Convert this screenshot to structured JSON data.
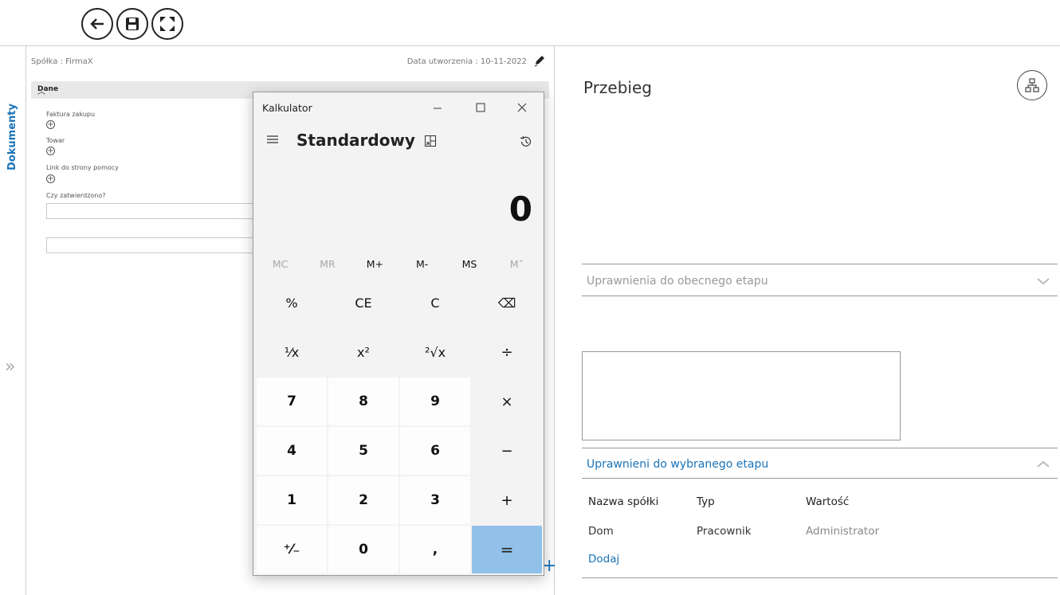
{
  "toolbar": {
    "buttons": [
      {
        "icon": "back-arrow-icon"
      },
      {
        "icon": "save-icon"
      },
      {
        "icon": "fullscreen-icon"
      }
    ]
  },
  "side_tab": {
    "label": "Dokumenty"
  },
  "document": {
    "company": "Spółka : FirmaX",
    "created": "Data utworzenia : 10-11-2022",
    "section_title": "Dane",
    "fields": {
      "invoice": "Faktura zakupu",
      "goods": "Towar",
      "help_link": "Link do strony pomocy",
      "approved": "Czy zatwierdzono?"
    }
  },
  "right_panel": {
    "title": "Przebieg",
    "current_permissions": "Uprawnienia do obecnego etapu",
    "selected_permissions": "Uprawnieni do wybranego etapu",
    "table": {
      "headers": [
        "Nazwa spółki",
        "Typ",
        "Wartość"
      ],
      "row": [
        "Dom",
        "Pracownik",
        "Administrator"
      ]
    },
    "add_label": "Dodaj"
  },
  "calculator": {
    "window_title": "Kalkulator",
    "mode": "Standardowy",
    "display": "0",
    "memory": [
      "MC",
      "MR",
      "M+",
      "M-",
      "MS",
      "M˅"
    ],
    "keys": {
      "percent": "%",
      "ce": "CE",
      "c": "C",
      "backspace": "⌫",
      "reciprocal": "¹⁄x",
      "square": "x²",
      "sqrt": "²√x",
      "divide": "÷",
      "seven": "7",
      "eight": "8",
      "nine": "9",
      "multiply": "×",
      "four": "4",
      "five": "5",
      "six": "6",
      "minus": "−",
      "one": "1",
      "two": "2",
      "three": "3",
      "plus": "+",
      "negate": "⁺⁄₋",
      "zero": "0",
      "decimal": ",",
      "equals": "="
    },
    "accent_color": "#91c1e8"
  },
  "colors": {
    "link": "#1a73b8"
  }
}
